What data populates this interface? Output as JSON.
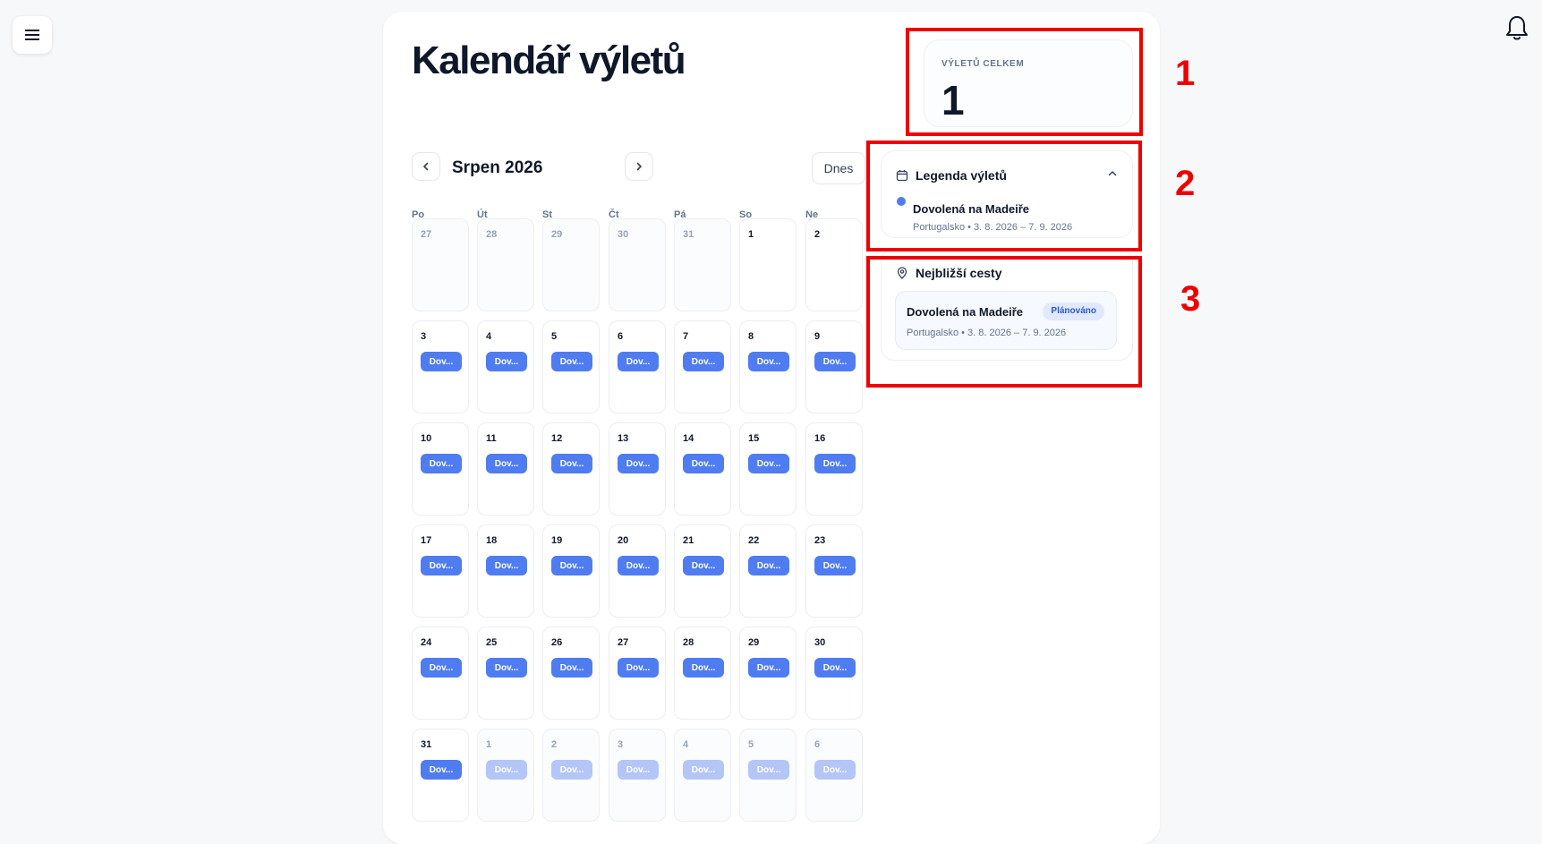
{
  "app": {
    "title": "Kalendář výletů",
    "menu_icon": "hamburger-icon",
    "bell_icon": "bell-icon"
  },
  "stats": {
    "label": "VÝLETŮ CELKEM",
    "value": "1"
  },
  "calendar": {
    "month": "Srpen 2026",
    "today_label": "Dnes",
    "weekdays": [
      "Po",
      "Út",
      "St",
      "Čt",
      "Pá",
      "So",
      "Ne"
    ],
    "event_label": "Dov...",
    "weeks": [
      [
        {
          "n": "27",
          "m": true,
          "e": false
        },
        {
          "n": "28",
          "m": true,
          "e": false
        },
        {
          "n": "29",
          "m": true,
          "e": false
        },
        {
          "n": "30",
          "m": true,
          "e": false
        },
        {
          "n": "31",
          "m": true,
          "e": false
        },
        {
          "n": "1",
          "m": false,
          "e": false
        },
        {
          "n": "2",
          "m": false,
          "e": false
        }
      ],
      [
        {
          "n": "3",
          "m": false,
          "e": true
        },
        {
          "n": "4",
          "m": false,
          "e": true
        },
        {
          "n": "5",
          "m": false,
          "e": true
        },
        {
          "n": "6",
          "m": false,
          "e": true
        },
        {
          "n": "7",
          "m": false,
          "e": true
        },
        {
          "n": "8",
          "m": false,
          "e": true
        },
        {
          "n": "9",
          "m": false,
          "e": true
        }
      ],
      [
        {
          "n": "10",
          "m": false,
          "e": true
        },
        {
          "n": "11",
          "m": false,
          "e": true
        },
        {
          "n": "12",
          "m": false,
          "e": true
        },
        {
          "n": "13",
          "m": false,
          "e": true
        },
        {
          "n": "14",
          "m": false,
          "e": true
        },
        {
          "n": "15",
          "m": false,
          "e": true
        },
        {
          "n": "16",
          "m": false,
          "e": true
        }
      ],
      [
        {
          "n": "17",
          "m": false,
          "e": true
        },
        {
          "n": "18",
          "m": false,
          "e": true
        },
        {
          "n": "19",
          "m": false,
          "e": true
        },
        {
          "n": "20",
          "m": false,
          "e": true
        },
        {
          "n": "21",
          "m": false,
          "e": true
        },
        {
          "n": "22",
          "m": false,
          "e": true
        },
        {
          "n": "23",
          "m": false,
          "e": true
        }
      ],
      [
        {
          "n": "24",
          "m": false,
          "e": true
        },
        {
          "n": "25",
          "m": false,
          "e": true
        },
        {
          "n": "26",
          "m": false,
          "e": true
        },
        {
          "n": "27",
          "m": false,
          "e": true
        },
        {
          "n": "28",
          "m": false,
          "e": true
        },
        {
          "n": "29",
          "m": false,
          "e": true
        },
        {
          "n": "30",
          "m": false,
          "e": true
        }
      ],
      [
        {
          "n": "31",
          "m": false,
          "e": true
        },
        {
          "n": "1",
          "m": true,
          "e": true
        },
        {
          "n": "2",
          "m": true,
          "e": true
        },
        {
          "n": "3",
          "m": true,
          "e": true
        },
        {
          "n": "4",
          "m": true,
          "e": true
        },
        {
          "n": "5",
          "m": true,
          "e": true
        },
        {
          "n": "6",
          "m": true,
          "e": true
        }
      ]
    ]
  },
  "legend": {
    "title": "Legenda výletů",
    "icon": "calendar-icon",
    "items": [
      {
        "name": "Dovolená na Madeiře",
        "meta": "Portugalsko • 3. 8. 2026 – 7. 9. 2026",
        "color": "#4f7cf0"
      }
    ]
  },
  "upcoming": {
    "title": "Nejbližší cesty",
    "icon": "map-pin-icon",
    "items": [
      {
        "name": "Dovolená na Madeiře",
        "status": "Plánováno",
        "meta": "Portugalsko • 3. 8. 2026 – 7. 9. 2026"
      }
    ]
  },
  "annotations": [
    "1",
    "2",
    "3"
  ],
  "colors": {
    "accent": "#4f7cf0",
    "annotation": "#e00000"
  }
}
